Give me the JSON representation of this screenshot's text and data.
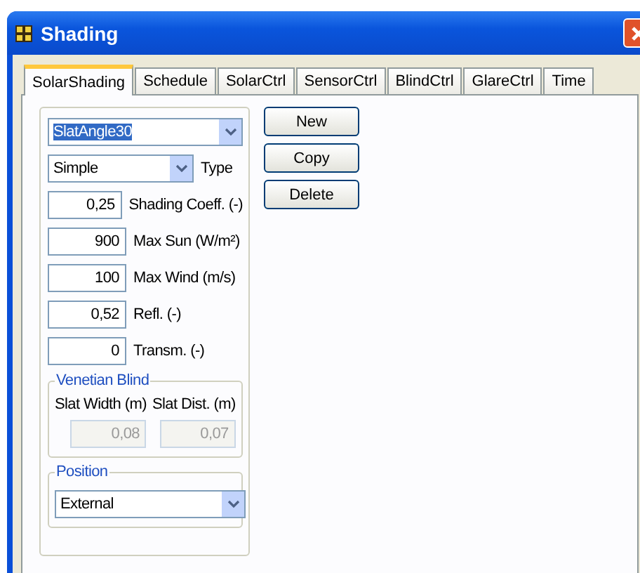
{
  "window": {
    "title": "Shading"
  },
  "tabs": [
    {
      "label": "SolarShading",
      "selected": true
    },
    {
      "label": "Schedule",
      "selected": false
    },
    {
      "label": "SolarCtrl",
      "selected": false
    },
    {
      "label": "SensorCtrl",
      "selected": false
    },
    {
      "label": "BlindCtrl",
      "selected": false
    },
    {
      "label": "GlareCtrl",
      "selected": false
    },
    {
      "label": "Time",
      "selected": false
    }
  ],
  "shading_select": {
    "value": "SlatAngle30"
  },
  "type_select": {
    "value": "Simple",
    "label": "Type"
  },
  "fields": [
    {
      "value": "0,25",
      "label": "Shading Coeff. (-)"
    },
    {
      "value": "900",
      "label": "Max Sun (W/m²)"
    },
    {
      "value": "100",
      "label": "Max Wind (m/s)"
    },
    {
      "value": "0,52",
      "label": "Refl. (-)"
    },
    {
      "value": "0",
      "label": "Transm. (-)"
    }
  ],
  "venetian_blind": {
    "title": "Venetian Blind",
    "fields": [
      {
        "label": "Slat Width (m)",
        "value": "0,08",
        "disabled": true
      },
      {
        "label": "Slat Dist. (m)",
        "value": "0,07",
        "disabled": true
      }
    ]
  },
  "position": {
    "title": "Position",
    "value": "External"
  },
  "buttons": [
    "New",
    "Copy",
    "Delete"
  ]
}
